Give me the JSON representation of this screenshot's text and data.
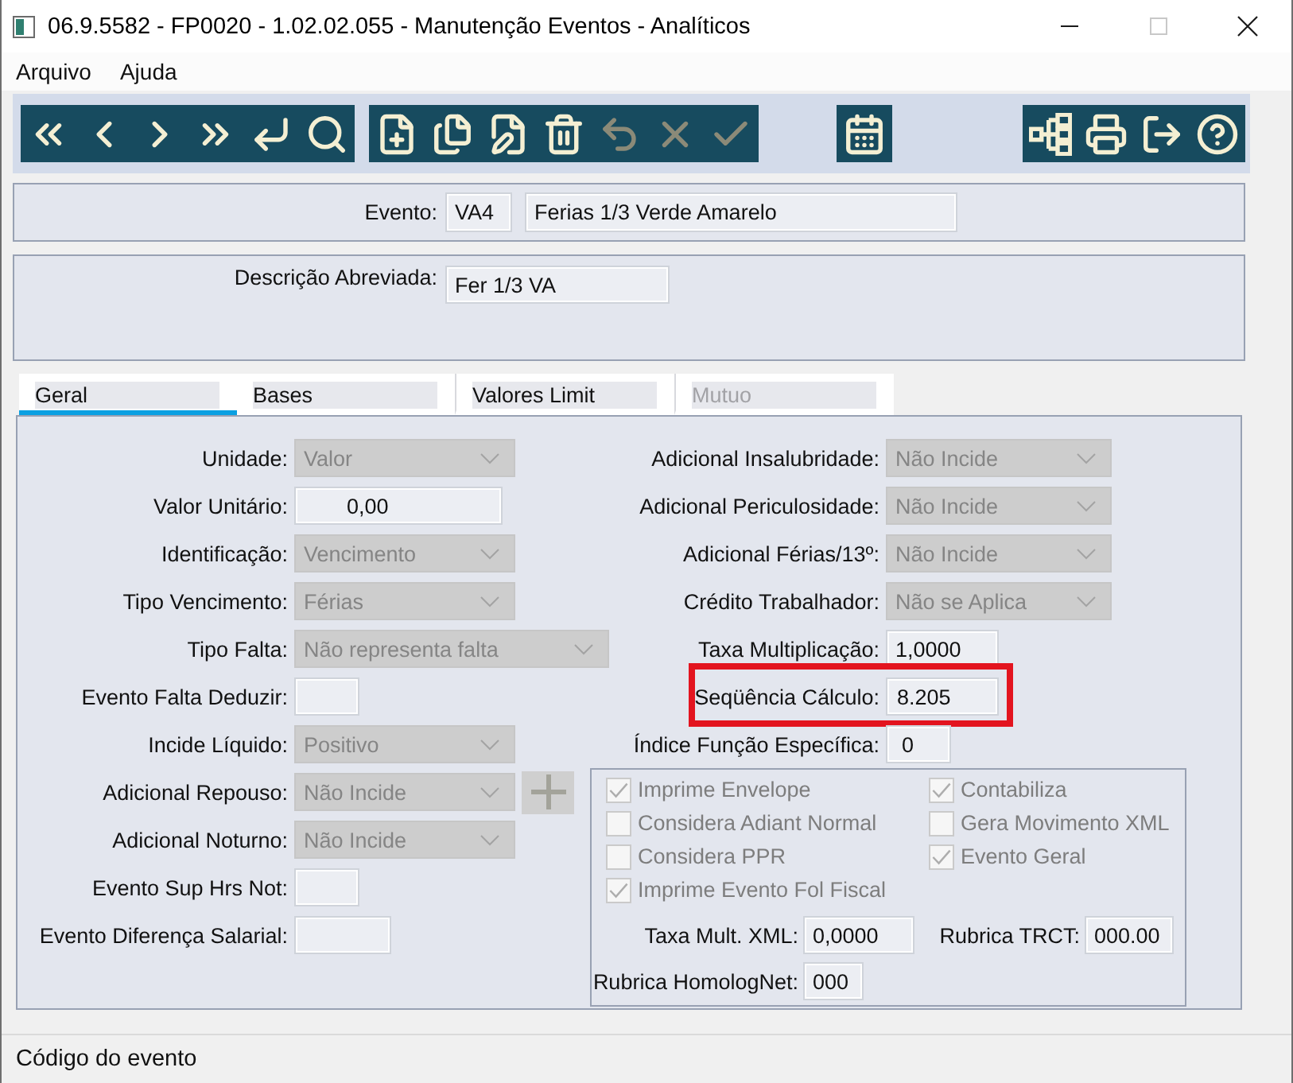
{
  "window": {
    "title": "06.9.5582 - FP0020 - 1.02.02.055 - Manutenção Eventos - Analíticos",
    "controls": [
      {
        "kind": "minimize",
        "disabled": false
      },
      {
        "kind": "maximize",
        "disabled": true
      },
      {
        "kind": "close",
        "disabled": false
      }
    ]
  },
  "menu": [
    "Arquivo",
    "Ajuda"
  ],
  "toolbar": {
    "groups": [
      {
        "buttons": [
          {
            "kind": "first",
            "disabled": false
          },
          {
            "kind": "previous",
            "disabled": false
          },
          {
            "kind": "next",
            "disabled": false
          },
          {
            "kind": "last",
            "disabled": false
          },
          {
            "kind": "enter",
            "disabled": false
          },
          {
            "kind": "search",
            "disabled": false
          }
        ]
      },
      {
        "buttons": [
          {
            "kind": "new",
            "disabled": false
          },
          {
            "kind": "copy",
            "disabled": false
          },
          {
            "kind": "edit",
            "disabled": false
          },
          {
            "kind": "delete",
            "disabled": false
          },
          {
            "kind": "undo",
            "disabled": true
          },
          {
            "kind": "cancel",
            "disabled": true
          },
          {
            "kind": "confirm",
            "disabled": true
          }
        ]
      },
      {
        "buttons": [
          {
            "kind": "calendar",
            "disabled": false
          }
        ]
      },
      {
        "buttons": [
          {
            "kind": "tree",
            "disabled": false
          },
          {
            "kind": "print",
            "disabled": false
          },
          {
            "kind": "exit",
            "disabled": false
          },
          {
            "kind": "help",
            "disabled": false
          }
        ]
      }
    ]
  },
  "event": {
    "label": "Evento:",
    "code": "VA4",
    "name": "Ferias 1/3 Verde Amarelo"
  },
  "short_description": {
    "label": "Descrição Abreviada:",
    "value": "Fer 1/3 VA"
  },
  "tabs": [
    {
      "label": "Geral",
      "selected": true,
      "disabled": false
    },
    {
      "label": "Bases",
      "selected": false,
      "disabled": false
    },
    {
      "label": "Valores Limit",
      "selected": false,
      "disabled": false
    },
    {
      "label": "Mutuo",
      "selected": false,
      "disabled": true
    }
  ],
  "general": {
    "left_fields": [
      {
        "label": "Unidade:",
        "kind": "select",
        "value": "Valor",
        "disabled": true
      },
      {
        "label": "Valor Unitário:",
        "kind": "input",
        "value": "0,00",
        "disabled": false
      },
      {
        "label": "Identificação:",
        "kind": "select",
        "value": "Vencimento",
        "disabled": true
      },
      {
        "label": "Tipo Vencimento:",
        "kind": "select",
        "value": "Férias",
        "disabled": true
      },
      {
        "label": "Tipo Falta:",
        "kind": "select",
        "value": "Não representa falta",
        "disabled": true
      },
      {
        "label": "Evento Falta Deduzir:",
        "kind": "input",
        "disabled": false
      },
      {
        "label": "Incide Líquido:",
        "kind": "select",
        "value": "Positivo",
        "disabled": true
      },
      {
        "label": "Adicional Repouso:",
        "kind": "select",
        "value": "Não Incide",
        "disabled": true,
        "add_button": {
          "disabled": true
        }
      },
      {
        "label": "Adicional Noturno:",
        "kind": "select",
        "value": "Não Incide",
        "disabled": true
      },
      {
        "label": "Evento Sup Hrs Not:",
        "kind": "input",
        "disabled": false
      },
      {
        "label": "Evento Diferença Salarial:",
        "kind": "input",
        "disabled": false
      }
    ],
    "right_fields": [
      {
        "label": "Adicional Insalubridade:",
        "kind": "select",
        "value": "Não Incide",
        "disabled": true
      },
      {
        "label": "Adicional Periculosidade:",
        "kind": "select",
        "value": "Não Incide",
        "disabled": true
      },
      {
        "label": "Adicional Férias/13º:",
        "kind": "select",
        "value": "Não Incide",
        "disabled": true
      },
      {
        "label": "Crédito Trabalhador:",
        "kind": "select",
        "value": "Não se Aplica",
        "disabled": true
      },
      {
        "label": "Taxa Multiplicação:",
        "kind": "input",
        "value": "1,0000",
        "disabled": false
      },
      {
        "label": "Seqüência Cálculo:",
        "kind": "input",
        "value": "8.205",
        "disabled": false,
        "highlighted": true
      },
      {
        "label": "Índice Função Específica:",
        "kind": "input",
        "value": "0",
        "disabled": false
      }
    ],
    "options_columns": [
      {
        "items": [
          {
            "label": "Imprime Envelope",
            "checked": true,
            "disabled": true
          },
          {
            "label": "Considera Adiant Normal",
            "checked": false,
            "disabled": true
          },
          {
            "label": "Considera PPR",
            "checked": false,
            "disabled": true
          },
          {
            "label": "Imprime Evento Fol Fiscal",
            "checked": true,
            "disabled": true
          }
        ]
      },
      {
        "items": [
          {
            "label": "Contabiliza",
            "checked": true,
            "disabled": true
          },
          {
            "label": "Gera Movimento XML",
            "checked": false,
            "disabled": true
          },
          {
            "label": "Evento Geral",
            "checked": true,
            "disabled": true
          }
        ]
      }
    ],
    "xml_fields": [
      {
        "label": "Taxa Mult. XML:",
        "value": "0,0000"
      },
      {
        "label": "Rubrica TRCT:",
        "value": "000.00"
      },
      {
        "label": "Rubrica HomologNet:",
        "value": "000"
      }
    ]
  },
  "status_bar": {
    "text": "Código do evento"
  }
}
